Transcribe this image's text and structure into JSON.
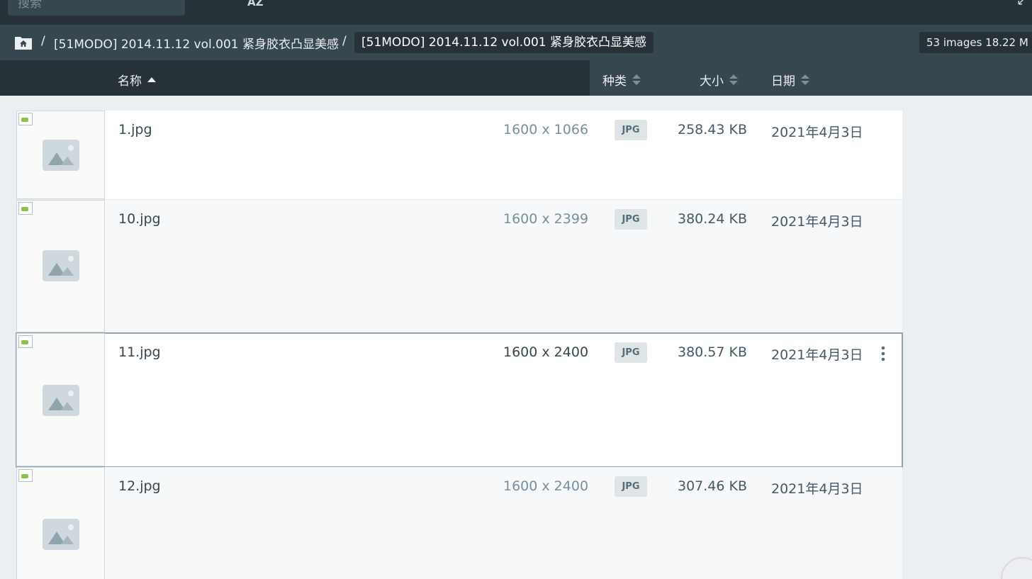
{
  "toolbar": {
    "search_placeholder": "搜索",
    "icons": [
      "list-view-icon",
      "sort-az-icon",
      "collapse-icon"
    ],
    "sort_az_label": "AZ"
  },
  "breadcrumb": {
    "separator": "/",
    "parent": "[51MODO] 2014.11.12 vol.001 紧身胶衣凸显美感",
    "current": "[51MODO] 2014.11.12 vol.001 紧身胶衣凸显美感",
    "stats": "53 images  18.22 M"
  },
  "columns": {
    "name": "名称",
    "type": "种类",
    "size": "大小",
    "date": "日期"
  },
  "files": [
    {
      "name": "1.jpg",
      "dimensions": "1600 x 1066",
      "type": "JPG",
      "size": "258.43 KB",
      "date": "2021年4月3日"
    },
    {
      "name": "10.jpg",
      "dimensions": "1600 x 2399",
      "type": "JPG",
      "size": "380.24 KB",
      "date": "2021年4月3日"
    },
    {
      "name": "11.jpg",
      "dimensions": "1600 x 2400",
      "type": "JPG",
      "size": "380.57 KB",
      "date": "2021年4月3日"
    },
    {
      "name": "12.jpg",
      "dimensions": "1600 x 2400",
      "type": "JPG",
      "size": "307.46 KB",
      "date": "2021年4月3日"
    }
  ],
  "colors": {
    "toolbar_bg": "#263238",
    "crumbbar_bg": "#37474f",
    "list_bg": "#eceff1",
    "badge_bg": "#dfe4e7"
  }
}
